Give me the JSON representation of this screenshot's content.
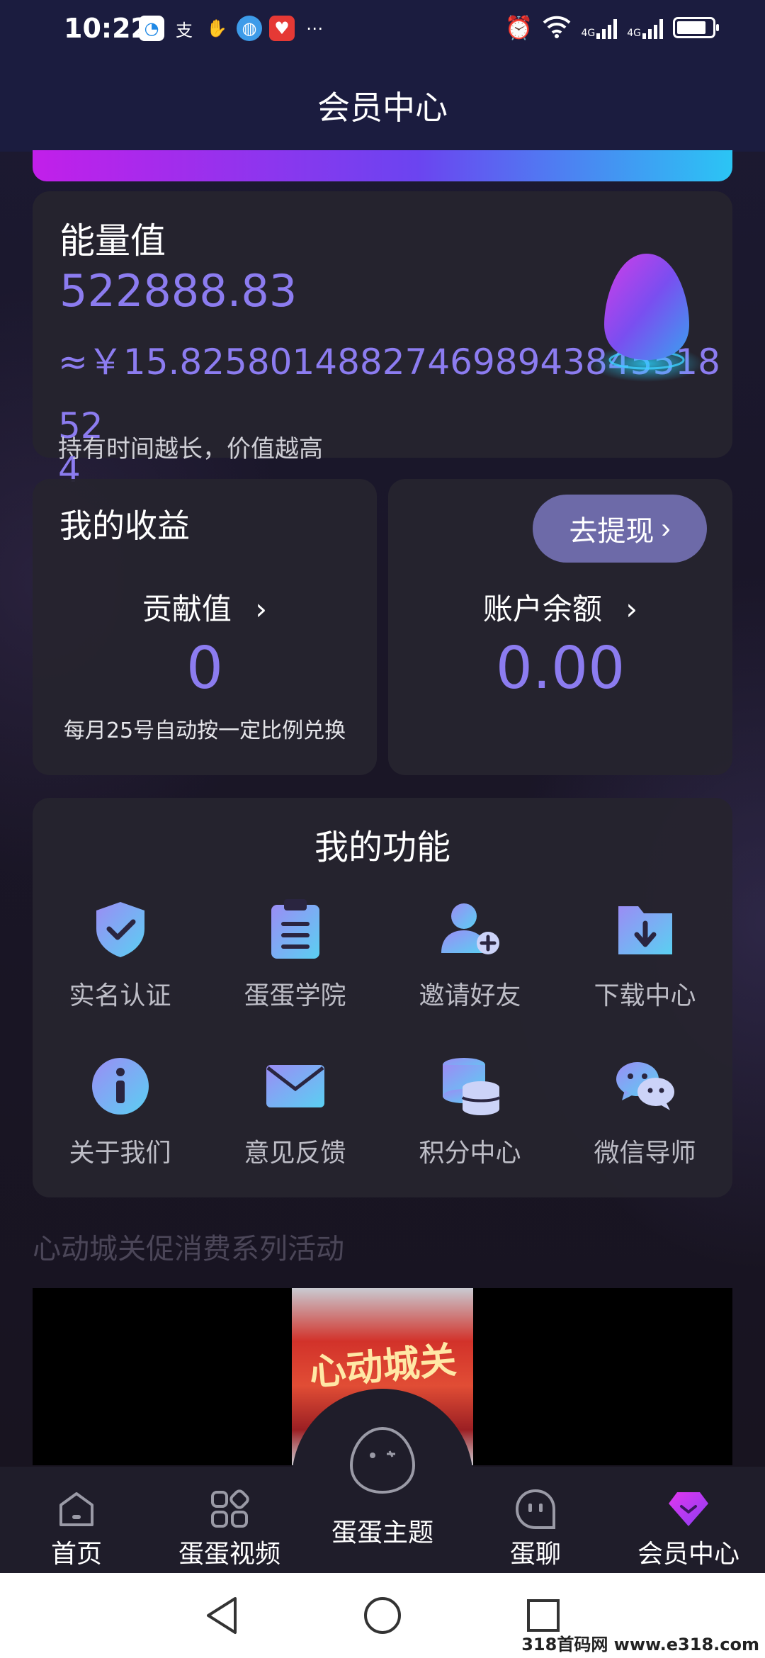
{
  "status_bar": {
    "time": "10:22",
    "network_1": "4G",
    "network_2": "4G"
  },
  "header": {
    "title": "会员中心"
  },
  "energy": {
    "title": "能量值",
    "value": "522888.83",
    "rmb": "≈￥15.82580148827469894384551852 4",
    "rmb_line1": "≈￥15.82580148827469894384551852",
    "rmb_line2": "4",
    "note": "持有时间越长，价值越高"
  },
  "income": {
    "title": "我的收益",
    "label": "贡献值",
    "value": "0",
    "note": "每月25号自动按一定比例兑换"
  },
  "balance": {
    "withdraw_label": "去提现",
    "label": "账户余额",
    "value": "0.00"
  },
  "functions": {
    "title": "我的功能",
    "items": [
      {
        "label": "实名认证",
        "icon": "shield-check-icon"
      },
      {
        "label": "蛋蛋学院",
        "icon": "clipboard-icon"
      },
      {
        "label": "邀请好友",
        "icon": "add-user-icon"
      },
      {
        "label": "下载中心",
        "icon": "download-folder-icon"
      },
      {
        "label": "关于我们",
        "icon": "info-icon"
      },
      {
        "label": "意见反馈",
        "icon": "mail-icon"
      },
      {
        "label": "积分中心",
        "icon": "coins-icon"
      },
      {
        "label": "微信导师",
        "icon": "wechat-icon"
      }
    ]
  },
  "promo": {
    "title": "心动城关促消费系列活动",
    "thumb_text": "心动城关"
  },
  "bottom_nav": [
    {
      "label": "首页",
      "icon": "home-icon"
    },
    {
      "label": "蛋蛋视频",
      "icon": "grid-icon"
    },
    {
      "label": "蛋蛋主题",
      "icon": "egg-face-icon"
    },
    {
      "label": "蛋聊",
      "icon": "chat-face-icon"
    },
    {
      "label": "会员中心",
      "icon": "diamond-icon"
    }
  ],
  "watermark": "318首码网 www.e318.com",
  "colors": {
    "accent": "#8c7cf0",
    "header_bg": "#1b1c3f",
    "card_bg": "#26242e",
    "withdraw_btn": "#6d6aa8"
  }
}
